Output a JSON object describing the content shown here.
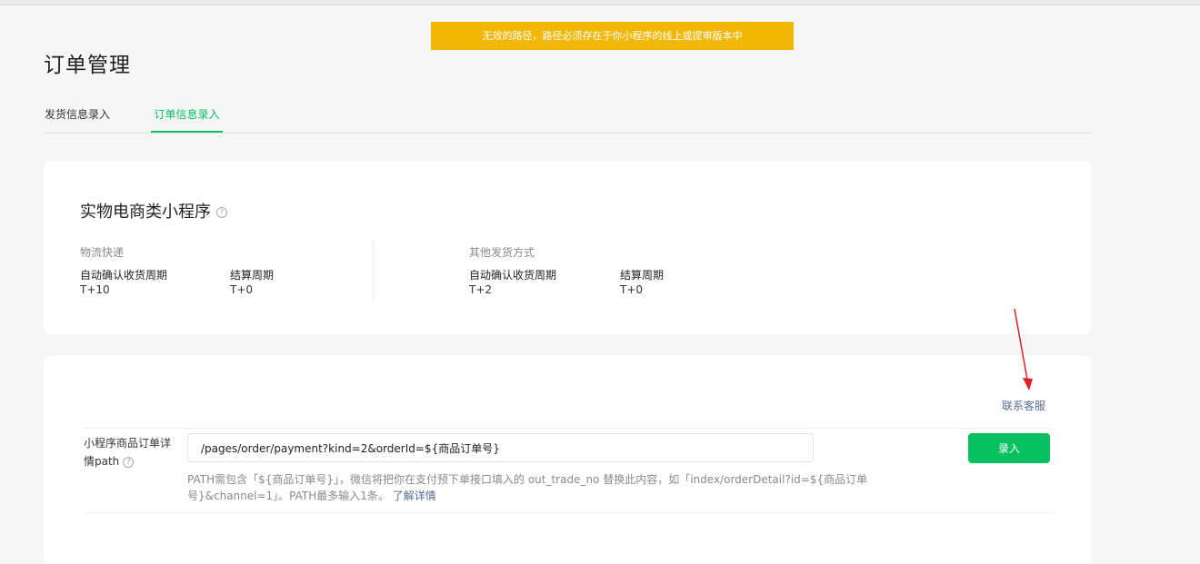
{
  "toast": {
    "message": "无效的路径，路径必须存在于你小程序的线上或提审版本中"
  },
  "page": {
    "title": "订单管理"
  },
  "tabs": [
    {
      "label": "发货信息录入",
      "active": false
    },
    {
      "label": "订单信息录入",
      "active": true
    }
  ],
  "settlement_card": {
    "title": "实物电商类小程序",
    "help_icon": "question-circle-icon",
    "groups": [
      {
        "label": "物流快递",
        "auto_confirm_label": "自动确认收货周期",
        "auto_confirm_value": "T+10",
        "settle_label": "结算周期",
        "settle_value": "T+0"
      },
      {
        "label": "其他发货方式",
        "auto_confirm_label": "自动确认收货周期",
        "auto_confirm_value": "T+2",
        "settle_label": "结算周期",
        "settle_value": "T+0"
      }
    ]
  },
  "path_form": {
    "contact_link": "联系客服",
    "label": "小程序商品订单详情path",
    "input_value": "/pages/order/payment?kind=2&orderId=${商品订单号}",
    "submit_label": "录入",
    "hint_text": "PATH需包含「${商品订单号}」，微信将把你在支付预下单接口填入的 out_trade_no 替换此内容，如「index/orderDetail?id=${商品订单号}&channel=1」。PATH最多输入1条。",
    "hint_link": "了解详情"
  },
  "colors": {
    "accent_green": "#07c160",
    "link_blue": "#576b95",
    "toast_yellow": "#f2b705",
    "annotation_red": "#e02020"
  }
}
